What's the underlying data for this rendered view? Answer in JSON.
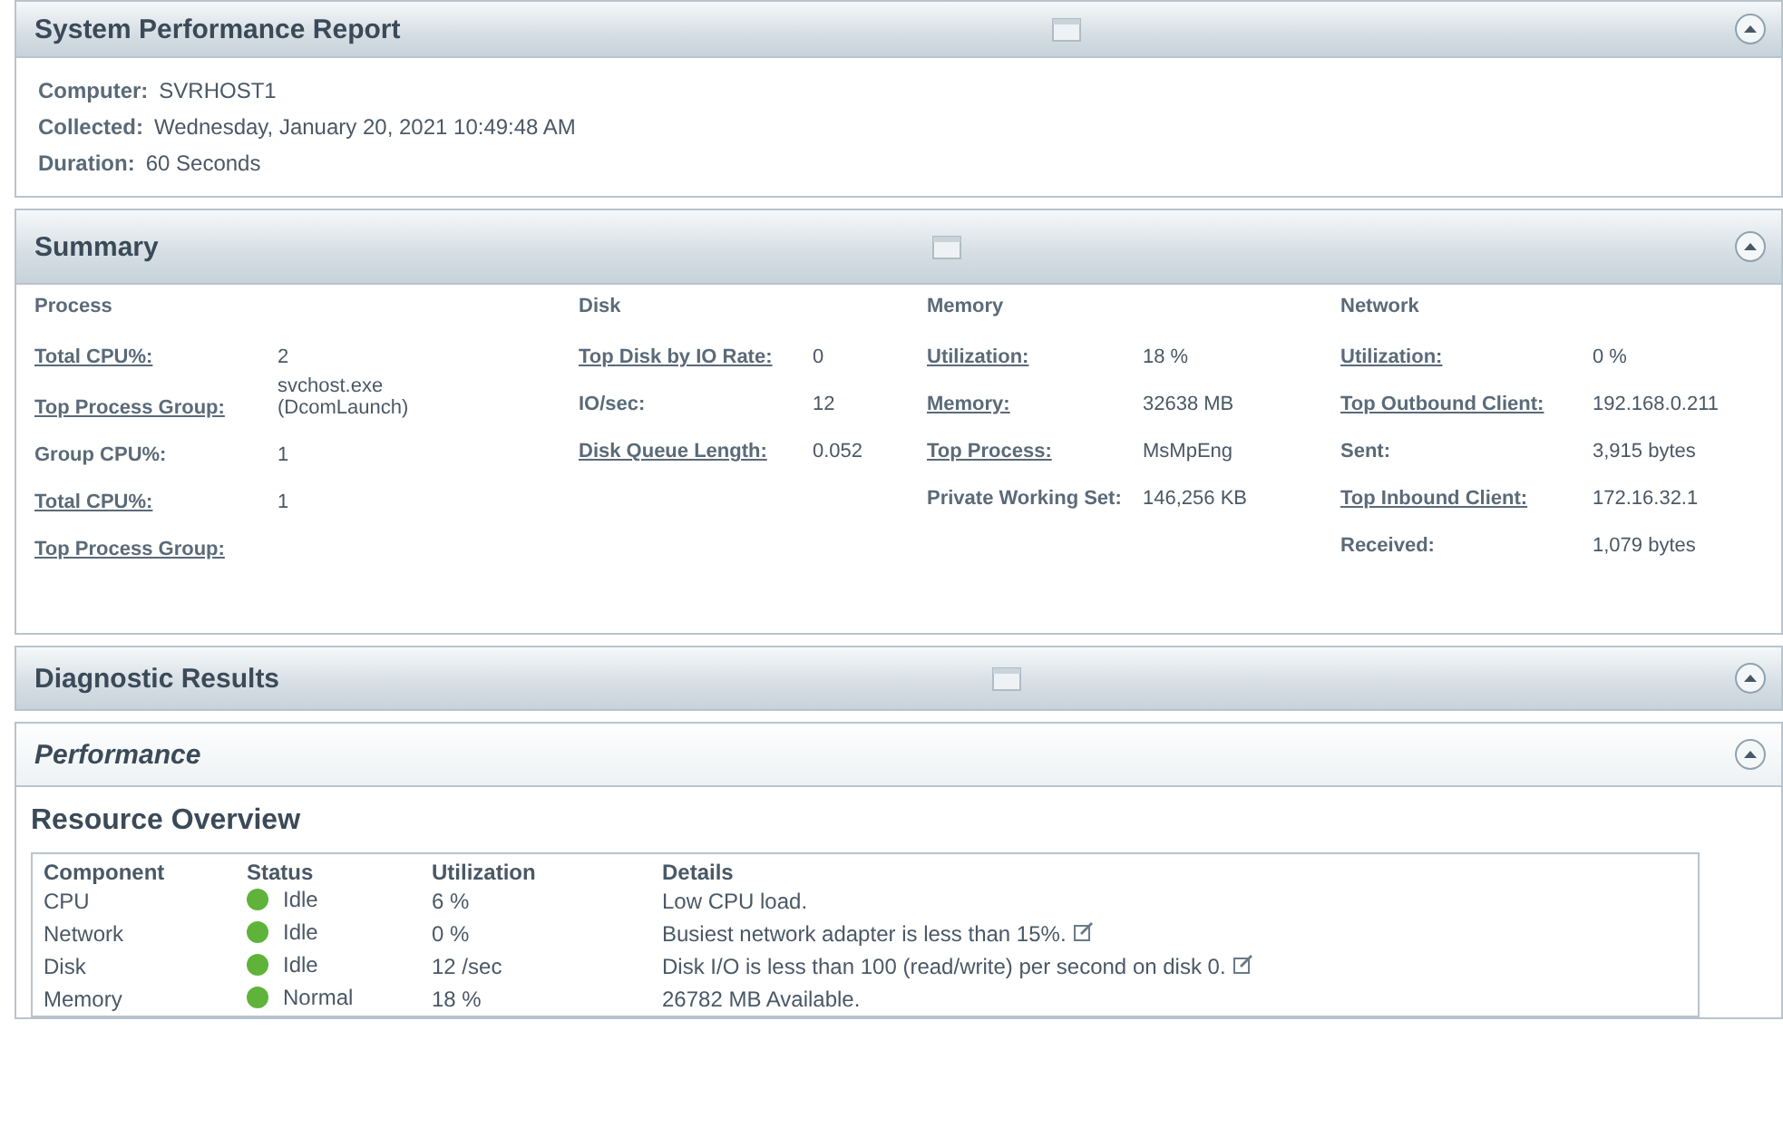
{
  "report": {
    "title": "System Performance Report",
    "expanded": true,
    "info": [
      {
        "label": "Computer:",
        "value": "SVRHOST1"
      },
      {
        "label": "Collected:",
        "value": "Wednesday, January 20, 2021 10:49:48 AM"
      },
      {
        "label": "Duration:",
        "value": "60 Seconds"
      }
    ]
  },
  "summary": {
    "title": "Summary",
    "expanded": true,
    "columns": [
      {
        "heading": "Process",
        "rows": [
          {
            "label": "Total CPU%:",
            "value": "2",
            "link": true
          },
          {
            "label": "Top Process Group:",
            "value": "svchost.exe (DcomLaunch)",
            "link": true
          },
          {
            "label": "Group CPU%:",
            "value": "1",
            "link": false
          },
          {
            "label": "Total CPU%:",
            "value": "1",
            "link": true
          },
          {
            "label": "Top Process Group:",
            "link": true
          }
        ]
      },
      {
        "heading": "Disk",
        "rows": [
          {
            "label": "Top Disk by IO Rate:",
            "value": "0",
            "link": true
          },
          {
            "label": "IO/sec:",
            "value": "12",
            "link": false
          },
          {
            "label": "Disk Queue Length:",
            "value": "0.052",
            "link": true
          }
        ]
      },
      {
        "heading": "Memory",
        "rows": [
          {
            "label": "Utilization:",
            "value": "18 %",
            "link": true
          },
          {
            "label": "Memory:",
            "value": "32638 MB",
            "link": true
          },
          {
            "label": "Top Process:",
            "value": "MsMpEng",
            "link": true
          },
          {
            "label": "Private Working Set:",
            "value": "146,256 KB",
            "link": false
          }
        ]
      },
      {
        "heading": "Network",
        "rows": [
          {
            "label": "Utilization:",
            "value": "0 %",
            "link": true
          },
          {
            "label": "Top Outbound Client:",
            "value": "192.168.0.211",
            "link": true
          },
          {
            "label": "Sent:",
            "value": "3,915 bytes",
            "link": false
          },
          {
            "label": "Top Inbound Client:",
            "value": "172.16.32.1",
            "link": true
          },
          {
            "label": "Received:",
            "value": "1,079 bytes",
            "link": false
          }
        ]
      }
    ]
  },
  "diagnostic": {
    "title": "Diagnostic Results",
    "expanded": true
  },
  "performance": {
    "title": "Performance",
    "expanded": true
  },
  "resource_overview": {
    "title": "Resource Overview",
    "columns": [
      "Component",
      "Status",
      "Utilization",
      "Details"
    ],
    "rows": [
      {
        "component": "CPU",
        "status": "Idle",
        "color": "#5fb33a",
        "utilization": "6 %",
        "details": "Low CPU load.",
        "note": false
      },
      {
        "component": "Network",
        "status": "Idle",
        "color": "#5fb33a",
        "utilization": "0 %",
        "details": "Busiest network adapter is less than 15%.",
        "note": true
      },
      {
        "component": "Disk",
        "status": "Idle",
        "color": "#5fb33a",
        "utilization": "12 /sec",
        "details": "Disk I/O is less than 100 (read/write) per second on disk 0.",
        "note": true
      },
      {
        "component": "Memory",
        "status": "Normal",
        "color": "#5fb33a",
        "utilization": "18 %",
        "details": "26782 MB Available.",
        "note": false
      }
    ]
  }
}
